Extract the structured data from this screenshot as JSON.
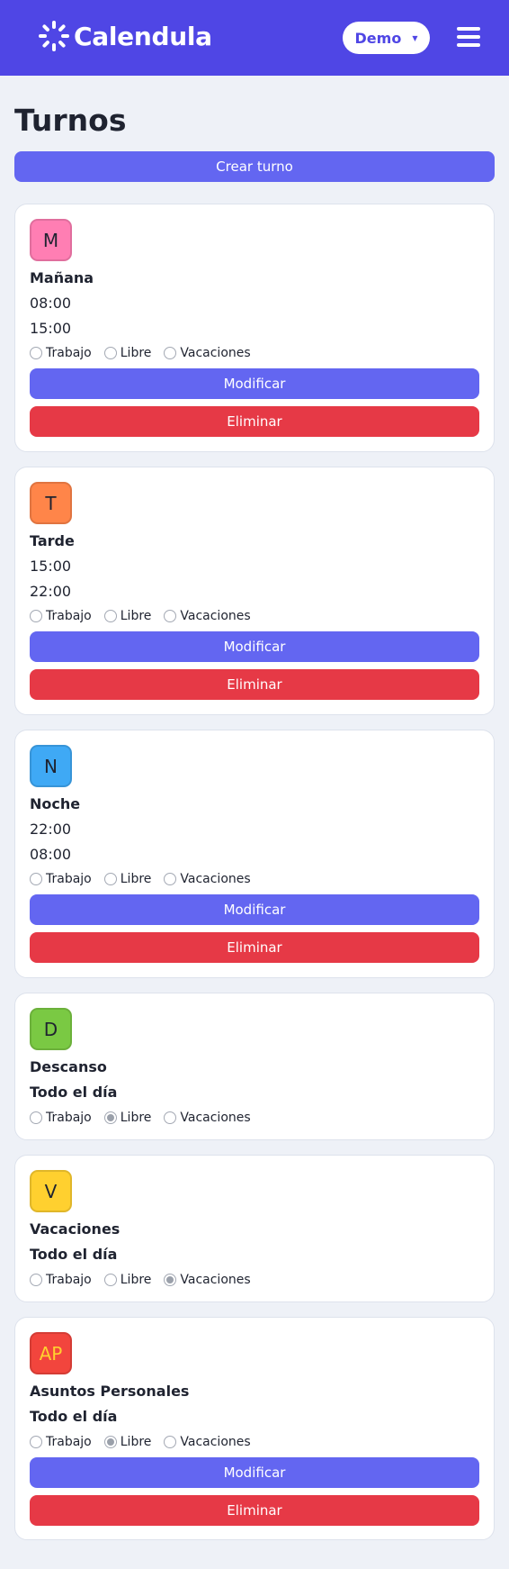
{
  "app": {
    "name": "Calendula",
    "user_select": "Demo"
  },
  "page": {
    "title": "Turnos",
    "create_label": "Crear turno"
  },
  "labels": {
    "trabajo": "Trabajo",
    "libre": "Libre",
    "vacaciones": "Vacaciones",
    "modificar": "Modificar",
    "eliminar": "Eliminar"
  },
  "shifts": [
    {
      "abbr": "M",
      "name": "Mañana",
      "start": "08:00",
      "end": "15:00",
      "type": "none",
      "color": "#ff7eb3",
      "text_color": "#1f2330"
    },
    {
      "abbr": "T",
      "name": "Tarde",
      "start": "15:00",
      "end": "22:00",
      "type": "none",
      "color": "#ff8549",
      "text_color": "#1f2330"
    },
    {
      "abbr": "N",
      "name": "Noche",
      "start": "22:00",
      "end": "08:00",
      "type": "none",
      "color": "#3fa9f5",
      "text_color": "#1f2330"
    },
    {
      "abbr": "D",
      "name": "Descanso",
      "all_day": "Todo el día",
      "type": "libre",
      "color": "#7ac943",
      "text_color": "#1f2330"
    },
    {
      "abbr": "V",
      "name": "Vacaciones",
      "all_day": "Todo el día",
      "type": "vacaciones",
      "color": "#ffd02f",
      "text_color": "#1f2330"
    },
    {
      "abbr": "AP",
      "name": "Asuntos Personales",
      "all_day": "Todo el día",
      "type": "libre",
      "color": "#f2453d",
      "text_color": "#ffd02f"
    }
  ]
}
